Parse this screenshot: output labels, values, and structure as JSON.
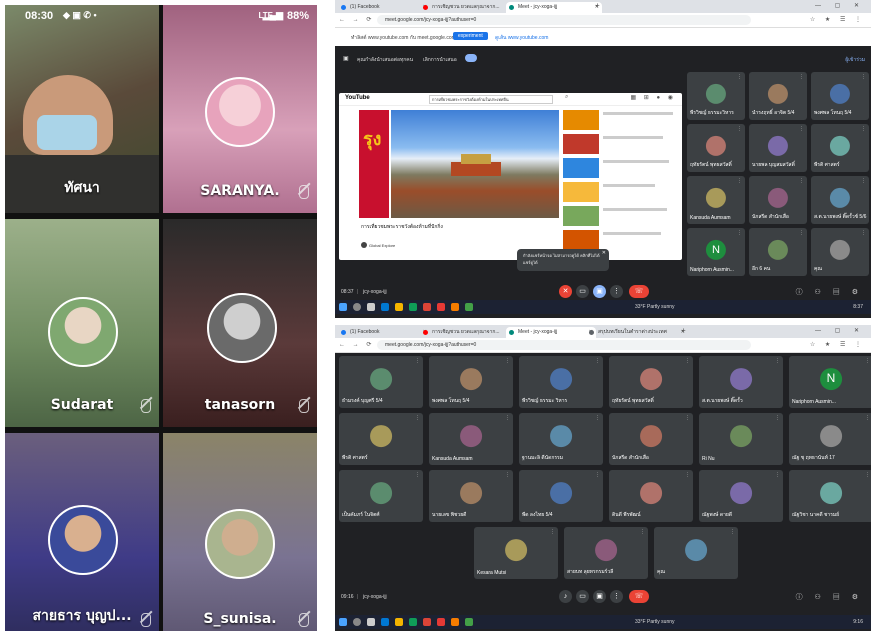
{
  "phone": {
    "time": "08:30",
    "battery": "88%",
    "network": "LTE",
    "tiles": [
      {
        "name": "ทัศนา"
      },
      {
        "name": "SARANYA."
      },
      {
        "name": "Sudarat"
      },
      {
        "name": "tanasorn"
      },
      {
        "name": "สายธาร บุญป..."
      },
      {
        "name": "S_sunisa."
      }
    ]
  },
  "deskA": {
    "tabs": [
      "(1) Facebook",
      "การเชิญชวน ยวดแลกุณาจาก...",
      "Meet - jcy-xoga-ijj"
    ],
    "url": "meet.google.com/jcy-xoga-ijj?authuser=0",
    "bookmarks": [
      "ทำลิสต์ www.youtube.com กับ meet.google.com",
      "experiment",
      "ดูเส้น www.youtube.com"
    ],
    "present_bar": {
      "title": "คุณกำลังนำเสนอต่อทุกคน",
      "stop": "เลิกการนำเสนอ",
      "right": "ผู้เข้าร่วม"
    },
    "youtube": {
      "logo": "YouTube",
      "search": "การเที่ยวชมพระราชวังต้องห้ามในประเทศจีน",
      "video_title": "การเที่ยวชมพระราชวังต้องห้ามที่ปักกิ่ง",
      "channel": "Global Explore"
    },
    "popup": "กำลังแชร์หน้าจอ ไม่สามารถดูได้ คลิกที่ไม่ได้แชร์ดูได้",
    "tiles": [
      {
        "name": "พีรวิชญ์ ธรรมะวิหาร"
      },
      {
        "name": "นำรงฤทธิ์ อาจิต 5/4"
      },
      {
        "name": "พงศพล โทนฤ 5/4"
      },
      {
        "name": "ฤทัยรัตน์ พุทธสวัสดิ์"
      },
      {
        "name": "นายพล บุญสมสวัสดิ์"
      },
      {
        "name": "พีรดิ ศาสตร์"
      },
      {
        "name": "Kansuda Aumsam"
      },
      {
        "name": "นักสรีด สำนักเสื่อ"
      },
      {
        "name": "ส.ต.นายพงษ์ ติ๊ดรั้วช์ 5/6"
      },
      {
        "name": "Nariphorn Ausmin..."
      },
      {
        "name": "อีก 6 คน"
      },
      {
        "name": "คุณ"
      }
    ],
    "time": "08:37",
    "meeting": "jcy-xoga-ijj",
    "taskbar_status": "33°F Partly sunny",
    "clock": "8:37"
  },
  "deskB": {
    "tabs": [
      "(1) Facebook",
      "การเชิญชวน ยวดแลกุณาจาก...",
      "Meet - jcy-xoga-ijj",
      "สรุปบทเรียนในตำราต่างประเทศ"
    ],
    "url": "meet.google.com/jcy-xoga-ijj?authuser=0",
    "tiles": [
      {
        "name": "ธำมรงค์ บุญศรี 5/4",
        "initial": ""
      },
      {
        "name": "พงศพล โทนฤ 5/4",
        "initial": ""
      },
      {
        "name": "พีรวิชญ์ ธรรมะ วิหาร",
        "initial": ""
      },
      {
        "name": "ฤทัยรัตน์ พุทธสวัสดิ์",
        "initial": ""
      },
      {
        "name": "ส.ต.นายพงษ์ ติ๊ดรั้ว",
        "initial": ""
      },
      {
        "name": "Nariphorn Ausmin...",
        "initial": "N"
      },
      {
        "name": "พีรดิ ศาสตร์",
        "initial": ""
      },
      {
        "name": "Kansuda Aumsam",
        "initial": ""
      },
      {
        "name": "ฐานมะลิ ดีนัดกรรม",
        "initial": ""
      },
      {
        "name": "นักสรีด สำนักเสื่อ",
        "initial": ""
      },
      {
        "name": "Ri Nu",
        "initial": ""
      },
      {
        "name": "ณัฐ ชุ ฤทธานันท์ 17",
        "initial": ""
      },
      {
        "name": "เป็นคัมภร์ ในจิตศ์",
        "initial": ""
      },
      {
        "name": "นายเลข พิชวยดี",
        "initial": ""
      },
      {
        "name": "พีด ลงไทย 5/4",
        "initial": ""
      },
      {
        "name": "ดินดี พีรพัฒน์",
        "initial": ""
      },
      {
        "name": "ณัฐพงษ์ ดายดี",
        "initial": ""
      },
      {
        "name": "ณัฐวิชา นาคดี ชารมย์",
        "initial": ""
      },
      {
        "name": "Kesara Mutsi",
        "initial": ""
      },
      {
        "name": "สายบท ลุยทรกรมร์วลี",
        "initial": ""
      },
      {
        "name": "คุณ",
        "initial": ""
      }
    ],
    "time": "09:16",
    "meeting": "jcy-xoga-ijj",
    "taskbar_status": "33°F Partly sunny",
    "clock": "9:16"
  }
}
